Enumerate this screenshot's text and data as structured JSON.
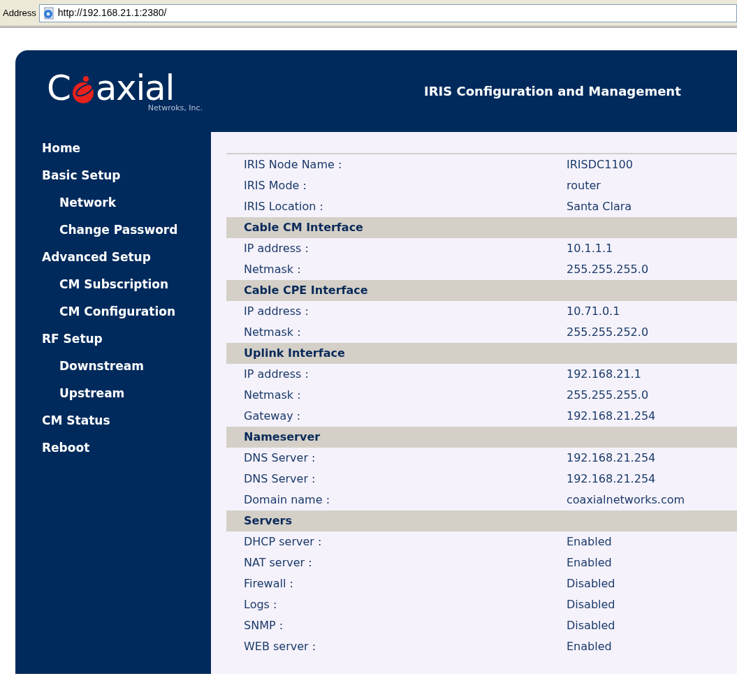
{
  "address_bar": {
    "label": "Address",
    "url": "http://192.168.21.1:2380/"
  },
  "logo": {
    "left": "C",
    "right": "axial",
    "tagline": "Netwroks, Inc."
  },
  "header": {
    "title": "IRIS Configuration and Management"
  },
  "sidebar": {
    "items": [
      {
        "label": "Home"
      },
      {
        "label": "Basic Setup",
        "children": [
          {
            "label": "Network"
          },
          {
            "label": "Change Password"
          }
        ]
      },
      {
        "label": "Advanced Setup",
        "children": [
          {
            "label": "CM Subscription"
          },
          {
            "label": "CM Configuration"
          }
        ]
      },
      {
        "label": "RF Setup",
        "children": [
          {
            "label": "Downstream"
          },
          {
            "label": "Upstream"
          }
        ]
      },
      {
        "label": "CM Status"
      },
      {
        "label": "Reboot"
      }
    ]
  },
  "table": {
    "rows": [
      {
        "kind": "row",
        "label": "IRIS Node Name :",
        "value": "IRISDC1100"
      },
      {
        "kind": "row",
        "label": "IRIS Mode :",
        "value": "router"
      },
      {
        "kind": "row",
        "label": "IRIS Location :",
        "value": "Santa Clara"
      },
      {
        "kind": "section",
        "label": "Cable CM Interface"
      },
      {
        "kind": "row",
        "label": "IP address :",
        "value": "10.1.1.1"
      },
      {
        "kind": "row",
        "label": "Netmask :",
        "value": "255.255.255.0"
      },
      {
        "kind": "section",
        "label": "Cable CPE Interface"
      },
      {
        "kind": "row",
        "label": "IP address :",
        "value": "10.71.0.1"
      },
      {
        "kind": "row",
        "label": "Netmask :",
        "value": "255.255.252.0"
      },
      {
        "kind": "section",
        "label": "Uplink Interface"
      },
      {
        "kind": "row",
        "label": "IP address :",
        "value": "192.168.21.1"
      },
      {
        "kind": "row",
        "label": "Netmask :",
        "value": "255.255.255.0"
      },
      {
        "kind": "row",
        "label": "Gateway :",
        "value": "192.168.21.254"
      },
      {
        "kind": "section",
        "label": "Nameserver"
      },
      {
        "kind": "row",
        "label": "DNS Server :",
        "value": "192.168.21.254"
      },
      {
        "kind": "row",
        "label": "DNS Server :",
        "value": "192.168.21.254"
      },
      {
        "kind": "row",
        "label": "Domain name :",
        "value": "coaxialnetworks.com"
      },
      {
        "kind": "section",
        "label": "Servers"
      },
      {
        "kind": "row",
        "label": "DHCP server :",
        "value": "Enabled"
      },
      {
        "kind": "row",
        "label": "NAT server :",
        "value": "Enabled"
      },
      {
        "kind": "row",
        "label": "Firewall :",
        "value": "Disabled"
      },
      {
        "kind": "row",
        "label": "Logs :",
        "value": "Disabled"
      },
      {
        "kind": "row",
        "label": "SNMP :",
        "value": "Disabled"
      },
      {
        "kind": "row",
        "label": "WEB server :",
        "value": "Enabled"
      }
    ]
  }
}
